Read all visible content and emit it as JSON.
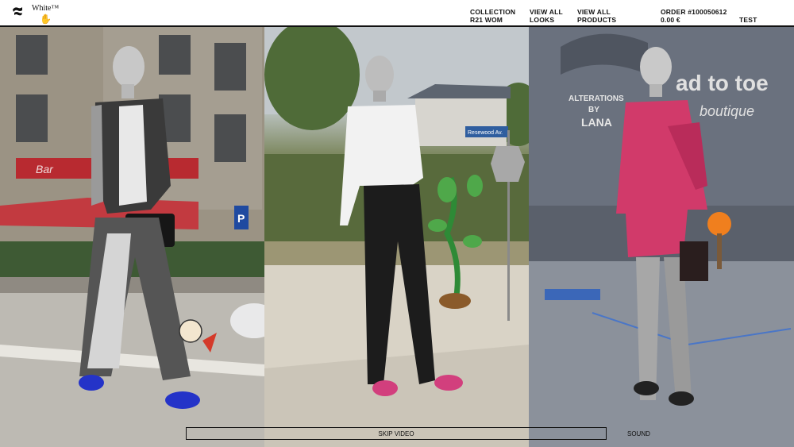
{
  "header": {
    "brand": "White™",
    "nav": {
      "collection_line1": "COLLECTION",
      "collection_line2": "R21 WOM",
      "looks_line1": "VIEW ALL",
      "looks_line2": "LOOKS",
      "products_line1": "VIEW ALL",
      "products_line2": "PRODUCTS",
      "order_line1": "ORDER #100050612",
      "order_line2": "0.00 €",
      "customer": "TEST CUSTOMER"
    }
  },
  "video": {
    "panel1": {
      "shop_sign": "Bar"
    },
    "panel2": {
      "street_sign": "Resewood Av."
    },
    "panel3": {
      "storefront_line1": "ALTERATIONS",
      "storefront_line2": "BY",
      "storefront_line3": "LANA",
      "storefront_big": "ad to toe",
      "storefront_script": "boutique"
    }
  },
  "footer": {
    "skip_label": "SKIP VIDEO",
    "sound_label": "SOUND"
  },
  "icons": [
    "logo-icon",
    "hand-icon"
  ],
  "colors": {
    "accent_red": "#c4283a",
    "accent_pink": "#d23f7d",
    "accent_blue": "#2433c8",
    "text": "#111111",
    "background": "#ffffff"
  }
}
